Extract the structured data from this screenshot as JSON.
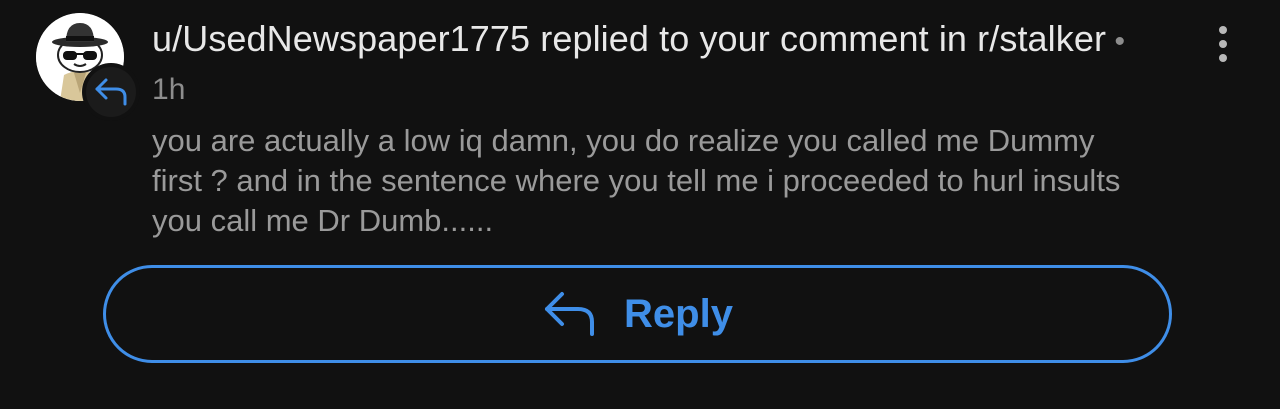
{
  "notification": {
    "username": "u/UsedNewspaper1775",
    "action": " replied to your comment in ",
    "subreddit": "r/stalker",
    "separator": " • ",
    "time": "1h",
    "body": "you are actually a low iq damn, you do realize you called me Dummy first ? and in the sentence where you tell me i proceeded to hurl insults you call me Dr Dumb......",
    "reply_label": "Reply"
  },
  "icons": {
    "avatar": "snoo-avatar-fedora-sunglasses",
    "badge": "reply-arrow-icon",
    "menu": "kebab-menu-icon",
    "reply": "reply-arrow-icon"
  },
  "colors": {
    "background": "#111111",
    "title": "#e8e8e8",
    "body": "#9a9a9a",
    "meta": "#8d8d8d",
    "accent": "#3f8ee8"
  }
}
